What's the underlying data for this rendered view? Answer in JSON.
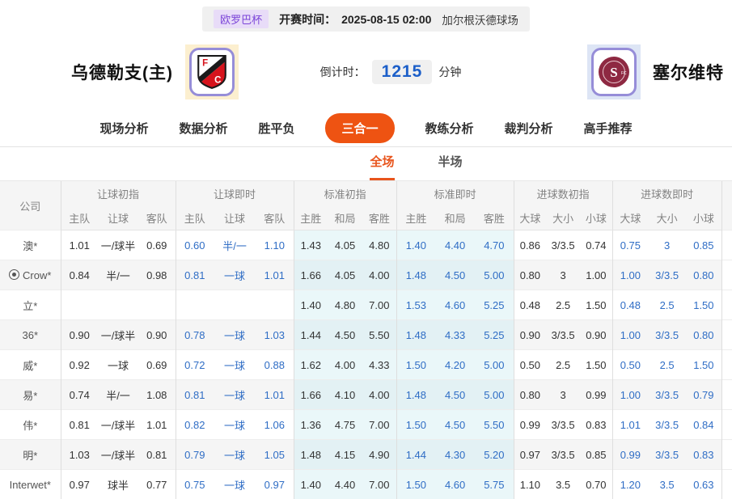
{
  "match_bar": {
    "league": "欧罗巴杯",
    "kickoff_label": "开赛时间：",
    "kickoff_time": "2025-08-15 02:00",
    "venue": "加尔根沃德球场"
  },
  "teams": {
    "home": {
      "name": "乌德勒支(主)"
    },
    "away": {
      "name": "塞尔维特"
    }
  },
  "countdown": {
    "label": "倒计时：",
    "value": "1215",
    "unit": "分钟"
  },
  "nav": {
    "tabs": [
      "现场分析",
      "数据分析",
      "胜平负",
      "三合一",
      "教练分析",
      "裁判分析",
      "高手推荐"
    ],
    "active": "三合一"
  },
  "subnav": {
    "tabs": [
      "全场",
      "半场"
    ],
    "active": "全场"
  },
  "odds_table": {
    "corner_header": "公司",
    "groups": [
      {
        "label": "让球初指",
        "cols": [
          "主队",
          "让球",
          "客队"
        ],
        "cyan": false,
        "live": false
      },
      {
        "label": "让球即时",
        "cols": [
          "主队",
          "让球",
          "客队"
        ],
        "cyan": false,
        "live": true
      },
      {
        "label": "标准初指",
        "cols": [
          "主胜",
          "和局",
          "客胜"
        ],
        "cyan": true,
        "live": false
      },
      {
        "label": "标准即时",
        "cols": [
          "主胜",
          "和局",
          "客胜"
        ],
        "cyan": true,
        "live": true
      },
      {
        "label": "进球数初指",
        "cols": [
          "大球",
          "大小",
          "小球"
        ],
        "cyan": false,
        "live": false
      },
      {
        "label": "进球数即时",
        "cols": [
          "大球",
          "大小",
          "小球"
        ],
        "cyan": false,
        "live": true
      }
    ],
    "rows": [
      {
        "company": "澳*",
        "icon": false,
        "values": [
          [
            "1.01",
            "一/球半",
            "0.69"
          ],
          [
            "0.60",
            "半/一",
            "1.10"
          ],
          [
            "1.43",
            "4.05",
            "4.80"
          ],
          [
            "1.40",
            "4.40",
            "4.70"
          ],
          [
            "0.86",
            "3/3.5",
            "0.74"
          ],
          [
            "0.75",
            "3",
            "0.85"
          ]
        ]
      },
      {
        "company": "Crow*",
        "icon": true,
        "values": [
          [
            "0.84",
            "半/一",
            "0.98"
          ],
          [
            "0.81",
            "一球",
            "1.01"
          ],
          [
            "1.66",
            "4.05",
            "4.00"
          ],
          [
            "1.48",
            "4.50",
            "5.00"
          ],
          [
            "0.80",
            "3",
            "1.00"
          ],
          [
            "1.00",
            "3/3.5",
            "0.80"
          ]
        ]
      },
      {
        "company": "立*",
        "icon": false,
        "values": [
          [
            "",
            "",
            ""
          ],
          [
            "",
            "",
            ""
          ],
          [
            "1.40",
            "4.80",
            "7.00"
          ],
          [
            "1.53",
            "4.60",
            "5.25"
          ],
          [
            "0.48",
            "2.5",
            "1.50"
          ],
          [
            "0.48",
            "2.5",
            "1.50"
          ]
        ]
      },
      {
        "company": "36*",
        "icon": false,
        "values": [
          [
            "0.90",
            "一/球半",
            "0.90"
          ],
          [
            "0.78",
            "一球",
            "1.03"
          ],
          [
            "1.44",
            "4.50",
            "5.50"
          ],
          [
            "1.48",
            "4.33",
            "5.25"
          ],
          [
            "0.90",
            "3/3.5",
            "0.90"
          ],
          [
            "1.00",
            "3/3.5",
            "0.80"
          ]
        ]
      },
      {
        "company": "威*",
        "icon": false,
        "values": [
          [
            "0.92",
            "一球",
            "0.69"
          ],
          [
            "0.72",
            "一球",
            "0.88"
          ],
          [
            "1.62",
            "4.00",
            "4.33"
          ],
          [
            "1.50",
            "4.20",
            "5.00"
          ],
          [
            "0.50",
            "2.5",
            "1.50"
          ],
          [
            "0.50",
            "2.5",
            "1.50"
          ]
        ]
      },
      {
        "company": "易*",
        "icon": false,
        "values": [
          [
            "0.74",
            "半/一",
            "1.08"
          ],
          [
            "0.81",
            "一球",
            "1.01"
          ],
          [
            "1.66",
            "4.10",
            "4.00"
          ],
          [
            "1.48",
            "4.50",
            "5.00"
          ],
          [
            "0.80",
            "3",
            "0.99"
          ],
          [
            "1.00",
            "3/3.5",
            "0.79"
          ]
        ]
      },
      {
        "company": "伟*",
        "icon": false,
        "values": [
          [
            "0.81",
            "一/球半",
            "1.01"
          ],
          [
            "0.82",
            "一球",
            "1.06"
          ],
          [
            "1.36",
            "4.75",
            "7.00"
          ],
          [
            "1.50",
            "4.50",
            "5.50"
          ],
          [
            "0.99",
            "3/3.5",
            "0.83"
          ],
          [
            "1.01",
            "3/3.5",
            "0.84"
          ]
        ]
      },
      {
        "company": "明*",
        "icon": false,
        "values": [
          [
            "1.03",
            "一/球半",
            "0.81"
          ],
          [
            "0.79",
            "一球",
            "1.05"
          ],
          [
            "1.48",
            "4.15",
            "4.90"
          ],
          [
            "1.44",
            "4.30",
            "5.20"
          ],
          [
            "0.97",
            "3/3.5",
            "0.85"
          ],
          [
            "0.99",
            "3/3.5",
            "0.83"
          ]
        ]
      },
      {
        "company": "Interwet*",
        "icon": false,
        "values": [
          [
            "0.97",
            "球半",
            "0.77"
          ],
          [
            "0.75",
            "一球",
            "0.97"
          ],
          [
            "1.40",
            "4.40",
            "7.00"
          ],
          [
            "1.50",
            "4.60",
            "5.75"
          ],
          [
            "1.10",
            "3.5",
            "0.70"
          ],
          [
            "1.20",
            "3.5",
            "0.63"
          ]
        ]
      }
    ]
  },
  "colors": {
    "accent_orange": "#ee5312",
    "subtab_orange": "#e8541c",
    "live_blue": "#2f6dc5",
    "badge_purple_bg": "#e8dcf8",
    "badge_purple_text": "#7b44d8",
    "cyan_column_bg": "#eaf7f9",
    "stripe_gray": "#f5f5f5",
    "countdown_blue": "#1c5fc9"
  }
}
